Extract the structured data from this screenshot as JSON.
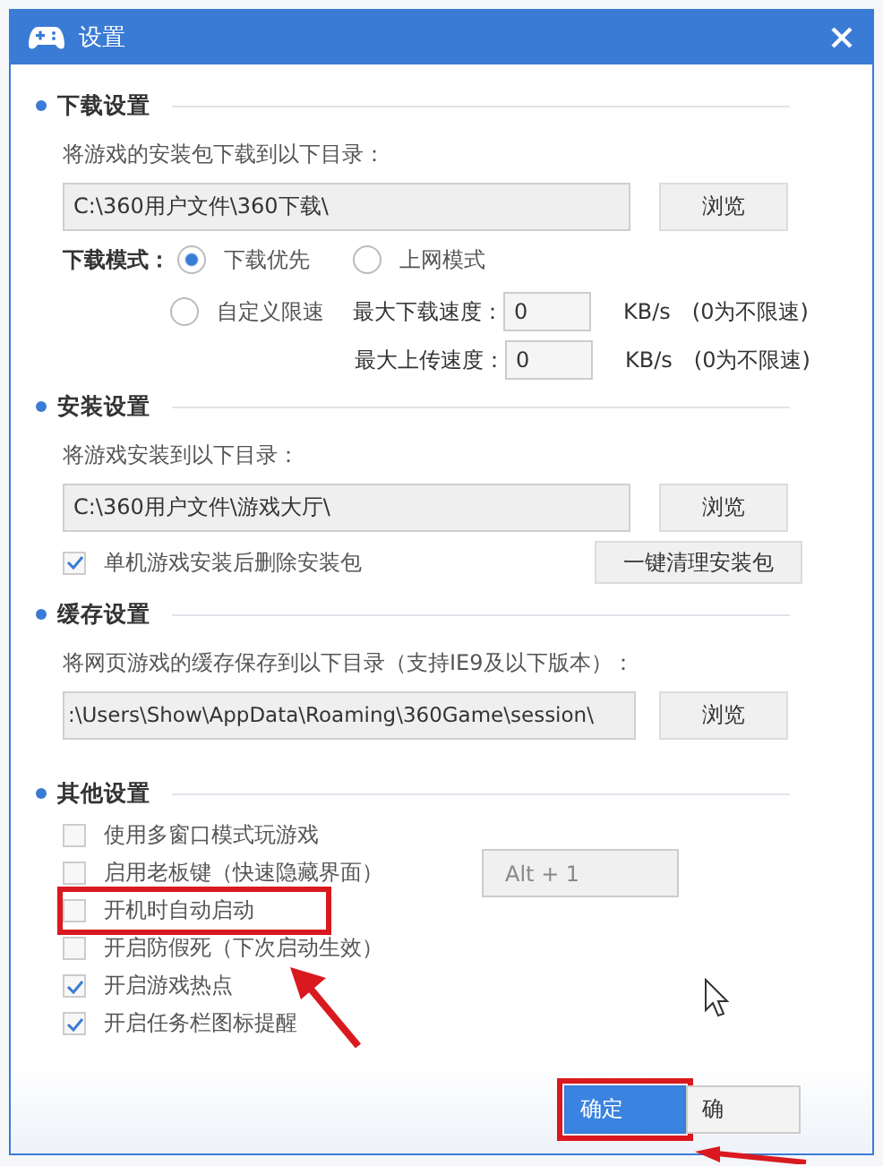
{
  "window": {
    "title": "设置"
  },
  "download": {
    "heading": "下载设置",
    "path_label": "将游戏的安装包下载到以下目录：",
    "path": "C:\\360用户文件\\360下载\\",
    "browse": "浏览",
    "mode_label": "下载模式：",
    "modes": [
      {
        "label": "下载优先",
        "selected": true
      },
      {
        "label": "上网模式",
        "selected": false
      },
      {
        "label": "自定义限速",
        "selected": false
      }
    ],
    "limits": [
      {
        "label": "最大下载速度：",
        "value": "0",
        "unit": "KB/s",
        "note": "(0为不限速)"
      },
      {
        "label": "最大上传速度：",
        "value": "0",
        "unit": "KB/s",
        "note": "(0为不限速)"
      }
    ]
  },
  "install": {
    "heading": "安装设置",
    "path_label": "将游戏安装到以下目录：",
    "path": "C:\\360用户文件\\游戏大厅\\",
    "browse": "浏览",
    "delete_option": {
      "label": "单机游戏安装后删除安装包",
      "checked": true
    },
    "clean_button": "一键清理安装包"
  },
  "cache": {
    "heading": "缓存设置",
    "path_label": "将网页游戏的缓存保存到以下目录（支持IE9及以下版本）：",
    "path": ":\\Users\\Show\\AppData\\Roaming\\360Game\\session\\",
    "browse": "浏览"
  },
  "other": {
    "heading": "其他设置",
    "options": [
      {
        "label": "使用多窗口模式玩游戏",
        "checked": false,
        "highlighted": false
      },
      {
        "label": "启用老板键（快速隐藏界面）",
        "checked": false,
        "highlighted": false,
        "hotkey": "Alt + 1"
      },
      {
        "label": "开机时自动启动",
        "checked": false,
        "highlighted": true
      },
      {
        "label": "开启防假死（下次启动生效）",
        "checked": false,
        "highlighted": false
      },
      {
        "label": "开启游戏热点",
        "checked": true,
        "highlighted": false
      },
      {
        "label": "开启任务栏图标提醒",
        "checked": true,
        "highlighted": false
      }
    ]
  },
  "footer": {
    "buttons": [
      {
        "label": "确定",
        "primary": true,
        "highlighted": true
      },
      {
        "label": "确",
        "primary": false,
        "highlighted": false
      }
    ]
  }
}
